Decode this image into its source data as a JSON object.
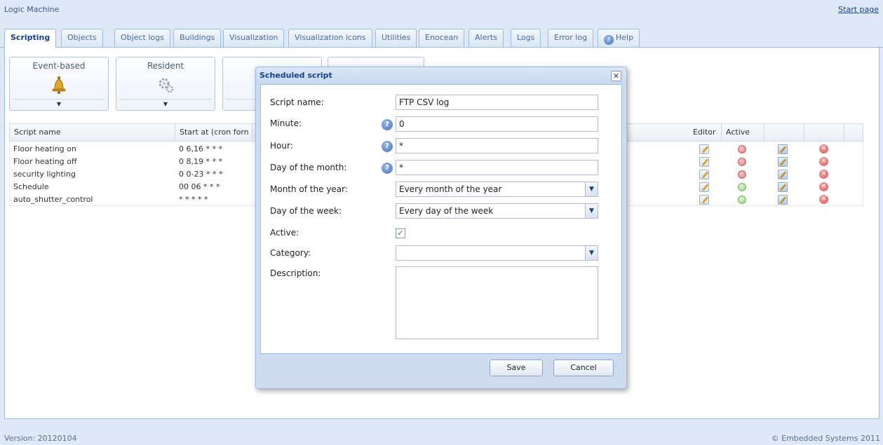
{
  "app": {
    "title": "Logic Machine",
    "start_page": "Start page"
  },
  "tabs": [
    {
      "label": "Scripting"
    },
    {
      "label": "Objects"
    },
    {
      "label": "Object logs"
    },
    {
      "label": "Buildings"
    },
    {
      "label": "Visualization"
    },
    {
      "label": "Visualization icons"
    },
    {
      "label": "Utilities"
    },
    {
      "label": "Enocean"
    },
    {
      "label": "Alerts"
    },
    {
      "label": "Logs"
    },
    {
      "label": "Error log"
    },
    {
      "label": "Help"
    }
  ],
  "toolbar": {
    "event_based": "Event-based",
    "resident": "Resident"
  },
  "grid": {
    "headers": {
      "script_name": "Script name",
      "start_at": "Start at (cron forn",
      "editor": "Editor",
      "active": "Active"
    },
    "rows": [
      {
        "name": "Floor heating on",
        "cron": "0 6,16 * * *",
        "active": false
      },
      {
        "name": "Floor heating off",
        "cron": "0 8,19 * * *",
        "active": false
      },
      {
        "name": "security lighting",
        "cron": "0 0-23 * * *",
        "active": false
      },
      {
        "name": "Schedule",
        "cron": "00 06 * * *",
        "active": true
      },
      {
        "name": "auto_shutter_control",
        "cron": "* * * * *",
        "active": true
      }
    ]
  },
  "dialog": {
    "title": "Scheduled script",
    "labels": {
      "script_name": "Script name:",
      "minute": "Minute:",
      "hour": "Hour:",
      "day_of_month": "Day of the month:",
      "month_of_year": "Month of the year:",
      "day_of_week": "Day of the week:",
      "active": "Active:",
      "category": "Category:",
      "description": "Description:"
    },
    "values": {
      "script_name": "FTP CSV log",
      "minute": "0",
      "hour": "*",
      "day_of_month": "*",
      "month_of_year": "Every month of the year",
      "day_of_week": "Every day of the week",
      "active": true,
      "category": "",
      "description": ""
    },
    "buttons": {
      "save": "Save",
      "cancel": "Cancel"
    },
    "close_glyph": "✕"
  },
  "footer": {
    "version": "Version: 20120104",
    "copyright": "© Embedded Systems 2011"
  }
}
